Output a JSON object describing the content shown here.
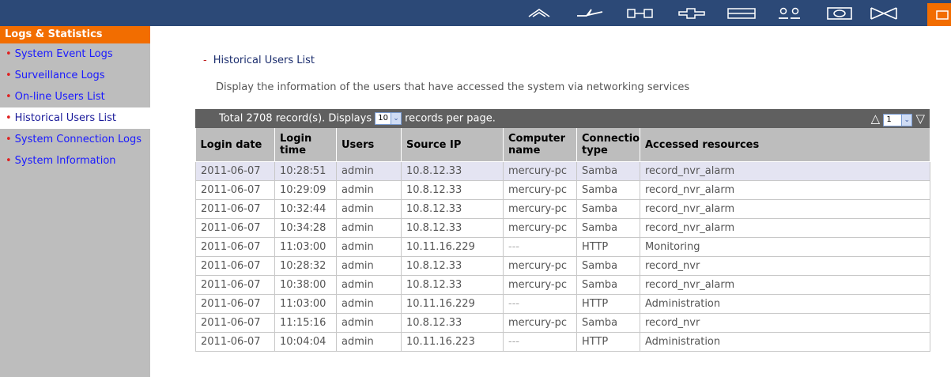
{
  "topbar": {
    "icons": [
      "home-icon",
      "network-icon",
      "device-icon",
      "plus-icon",
      "list-icon",
      "users-icon",
      "monitor-icon",
      "mail-icon"
    ]
  },
  "sidebar": {
    "heading": "Logs & Statistics",
    "items": [
      {
        "label": "System Event Logs"
      },
      {
        "label": "Surveillance Logs"
      },
      {
        "label": "On-line Users List"
      },
      {
        "label": "Historical Users List"
      },
      {
        "label": "System Connection Logs"
      },
      {
        "label": "System Information"
      }
    ]
  },
  "main": {
    "section_title": "Historical Users List",
    "description": "Display the information of the users that have accessed the system via networking services",
    "toolbar": {
      "total_prefix": "Total 2708 record(s).  Displays",
      "per_page": "10",
      "total_suffix": "records per page.",
      "page": "1"
    },
    "columns": [
      "Login date",
      "Login time",
      "Users",
      "Source IP",
      "Computer name",
      "Connection type",
      "Accessed resources"
    ],
    "rows": [
      [
        "2011-06-07",
        "10:28:51",
        "admin",
        "10.8.12.33",
        "mercury-pc",
        "Samba",
        "record_nvr_alarm"
      ],
      [
        "2011-06-07",
        "10:29:09",
        "admin",
        "10.8.12.33",
        "mercury-pc",
        "Samba",
        "record_nvr_alarm"
      ],
      [
        "2011-06-07",
        "10:32:44",
        "admin",
        "10.8.12.33",
        "mercury-pc",
        "Samba",
        "record_nvr_alarm"
      ],
      [
        "2011-06-07",
        "10:34:28",
        "admin",
        "10.8.12.33",
        "mercury-pc",
        "Samba",
        "record_nvr_alarm"
      ],
      [
        "2011-06-07",
        "11:03:00",
        "admin",
        "10.11.16.229",
        "---",
        "HTTP",
        "Monitoring"
      ],
      [
        "2011-06-07",
        "10:28:32",
        "admin",
        "10.8.12.33",
        "mercury-pc",
        "Samba",
        "record_nvr"
      ],
      [
        "2011-06-07",
        "10:38:00",
        "admin",
        "10.8.12.33",
        "mercury-pc",
        "Samba",
        "record_nvr_alarm"
      ],
      [
        "2011-06-07",
        "11:03:00",
        "admin",
        "10.11.16.229",
        "---",
        "HTTP",
        "Administration"
      ],
      [
        "2011-06-07",
        "11:15:16",
        "admin",
        "10.8.12.33",
        "mercury-pc",
        "Samba",
        "record_nvr"
      ],
      [
        "2011-06-07",
        "10:04:04",
        "admin",
        "10.11.16.223",
        "---",
        "HTTP",
        "Administration"
      ]
    ]
  },
  "colors": {
    "nav": "#2c4977",
    "accent": "#f26d00",
    "sidebar": "#bdbdbd",
    "table_bar": "#606060",
    "link": "#1a1aff"
  }
}
